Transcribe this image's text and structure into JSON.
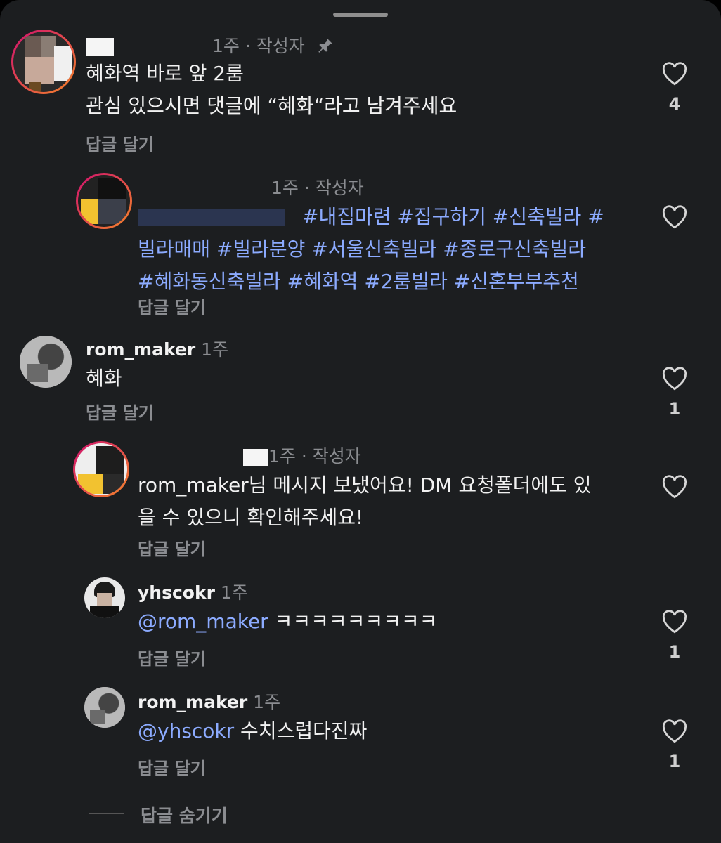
{
  "sheet": {
    "hide_replies": "답글 숨기기"
  },
  "comments": [
    {
      "time": "1주 · 작성자",
      "lines": [
        "혜화역 바로 앞 2룸",
        "관심 있으시면 댓글에 “혜화“라고 남겨주세요"
      ],
      "reply_label": "답글 달기",
      "likes": "4"
    },
    {
      "time": "1주 · 작성자",
      "tags_line1": "#내집마련 #집구하기 #신축빌라 #",
      "tags_line2": "빌라매매 #빌라분양 #서울신축빌라 #종로구신축빌라",
      "tags_line3": "#혜화동신축빌라 #혜화역 #2룸빌라 #신혼부부추천",
      "reply_label": "답글 달기",
      "likes": ""
    },
    {
      "user": "rom_maker",
      "time": "1주",
      "text": "혜화",
      "reply_label": "답글 달기",
      "likes": "1"
    },
    {
      "time": "1주 · 작성자",
      "line1": "rom_maker님 메시지 보냈어요! DM 요청폴더에도 있",
      "line2": "을 수 있으니 확인해주세요!",
      "reply_label": "답글 달기",
      "likes": ""
    },
    {
      "user": "yhscokr",
      "time": "1주",
      "mention": "@rom_maker",
      "text": " ㅋㅋㅋㅋㅋㅋㅋㅋㅋ",
      "reply_label": "답글 달기",
      "likes": "1"
    },
    {
      "user": "rom_maker",
      "time": "1주",
      "mention": "@yhscokr",
      "text": " 수치스럽다진짜",
      "reply_label": "답글 달기",
      "likes": "1"
    }
  ]
}
